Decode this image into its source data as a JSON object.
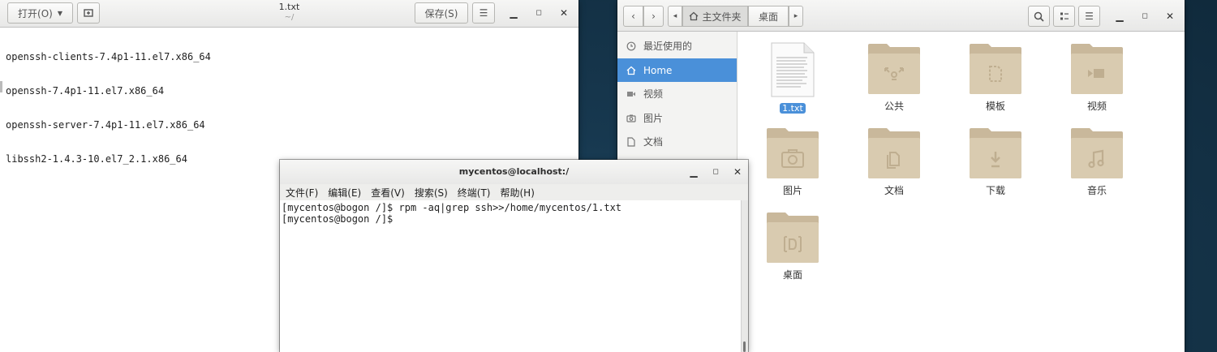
{
  "gedit": {
    "open_label": "打开(O)",
    "title": "1.txt",
    "subtitle": "~/",
    "save_label": "保存(S)",
    "lines": [
      "openssh-clients-7.4p1-11.el7.x86_64",
      "openssh-7.4p1-11.el7.x86_64",
      "openssh-server-7.4p1-11.el7.x86_64",
      "libssh2-1.4.3-10.el7_2.1.x86_64"
    ]
  },
  "files": {
    "path": [
      "主文件夹",
      "桌面"
    ],
    "sidebar": [
      "最近使用的",
      "Home",
      "视频",
      "图片",
      "文档"
    ],
    "items": [
      "1.txt",
      "公共",
      "模板",
      "视频",
      "图片",
      "文档",
      "下载",
      "音乐",
      "桌面"
    ]
  },
  "terminal": {
    "title": "mycentos@localhost:/",
    "menus": [
      "文件(F)",
      "编辑(E)",
      "查看(V)",
      "搜索(S)",
      "终端(T)",
      "帮助(H)"
    ],
    "lines": [
      "[mycentos@bogon /]$ rpm -aq|grep ssh>>/home/mycentos/1.txt",
      "[mycentos@bogon /]$ "
    ]
  },
  "colors": {
    "selection": "#4a90d9",
    "folder": "#d9cbb0",
    "desktop": "#17384f"
  }
}
